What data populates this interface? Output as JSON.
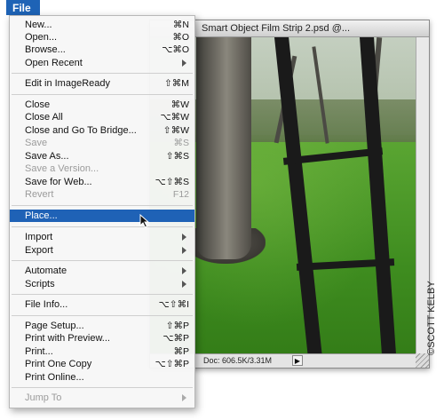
{
  "menubar": {
    "file_label": "File"
  },
  "document": {
    "title": "Smart Object Film Strip 2.psd @...",
    "status_text": "Doc: 606.5K/3.31M"
  },
  "file_menu": {
    "items": [
      {
        "label": "New...",
        "shortcut": "⌘N",
        "enabled": true
      },
      {
        "label": "Open...",
        "shortcut": "⌘O",
        "enabled": true
      },
      {
        "label": "Browse...",
        "shortcut": "⌥⌘O",
        "enabled": true
      },
      {
        "label": "Open Recent",
        "shortcut": "",
        "submenu": true,
        "enabled": true
      },
      {
        "label": "Edit in ImageReady",
        "shortcut": "⇧⌘M",
        "enabled": true
      },
      {
        "label": "Close",
        "shortcut": "⌘W",
        "enabled": true
      },
      {
        "label": "Close All",
        "shortcut": "⌥⌘W",
        "enabled": true
      },
      {
        "label": "Close and Go To Bridge...",
        "shortcut": "⇧⌘W",
        "enabled": true
      },
      {
        "label": "Save",
        "shortcut": "⌘S",
        "enabled": false
      },
      {
        "label": "Save As...",
        "shortcut": "⇧⌘S",
        "enabled": true
      },
      {
        "label": "Save a Version...",
        "shortcut": "",
        "enabled": false
      },
      {
        "label": "Save for Web...",
        "shortcut": "⌥⇧⌘S",
        "enabled": true
      },
      {
        "label": "Revert",
        "shortcut": "F12",
        "enabled": false
      },
      {
        "label": "Place...",
        "shortcut": "",
        "enabled": true,
        "selected": true
      },
      {
        "label": "Import",
        "shortcut": "",
        "submenu": true,
        "enabled": true
      },
      {
        "label": "Export",
        "shortcut": "",
        "submenu": true,
        "enabled": true
      },
      {
        "label": "Automate",
        "shortcut": "",
        "submenu": true,
        "enabled": true
      },
      {
        "label": "Scripts",
        "shortcut": "",
        "submenu": true,
        "enabled": true
      },
      {
        "label": "File Info...",
        "shortcut": "⌥⇧⌘I",
        "enabled": true
      },
      {
        "label": "Page Setup...",
        "shortcut": "⇧⌘P",
        "enabled": true
      },
      {
        "label": "Print with Preview...",
        "shortcut": "⌥⌘P",
        "enabled": true
      },
      {
        "label": "Print...",
        "shortcut": "⌘P",
        "enabled": true
      },
      {
        "label": "Print One Copy",
        "shortcut": "⌥⇧⌘P",
        "enabled": true
      },
      {
        "label": "Print Online...",
        "shortcut": "",
        "enabled": true
      },
      {
        "label": "Jump To",
        "shortcut": "",
        "submenu": true,
        "enabled": false
      }
    ]
  },
  "credit": "©SCOTT KELBY",
  "colors": {
    "selection": "#1f62b6",
    "menubar_highlight": "#1e63b6"
  }
}
